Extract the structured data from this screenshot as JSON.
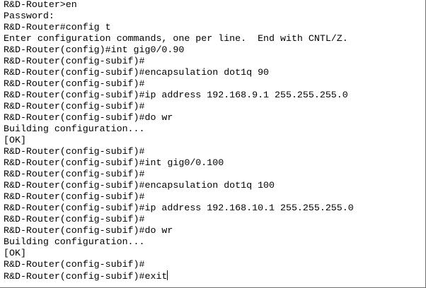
{
  "terminal": {
    "lines": [
      "R&D-Router>en",
      "Password:",
      "R&D-Router#config t",
      "Enter configuration commands, one per line.  End with CNTL/Z.",
      "R&D-Router(config)#int gig0/0.90",
      "R&D-Router(config-subif)#",
      "R&D-Router(config-subif)#encapsulation dot1q 90",
      "R&D-Router(config-subif)#",
      "R&D-Router(config-subif)#ip address 192.168.9.1 255.255.255.0",
      "R&D-Router(config-subif)#",
      "R&D-Router(config-subif)#do wr",
      "Building configuration...",
      "[OK]",
      "R&D-Router(config-subif)#",
      "R&D-Router(config-subif)#int gig0/0.100",
      "R&D-Router(config-subif)#",
      "R&D-Router(config-subif)#encapsulation dot1q 100",
      "R&D-Router(config-subif)#",
      "R&D-Router(config-subif)#ip address 192.168.10.1 255.255.255.0",
      "R&D-Router(config-subif)#",
      "R&D-Router(config-subif)#do wr",
      "Building configuration...",
      "[OK]",
      "R&D-Router(config-subif)#",
      "R&D-Router(config-subif)#exit"
    ]
  }
}
